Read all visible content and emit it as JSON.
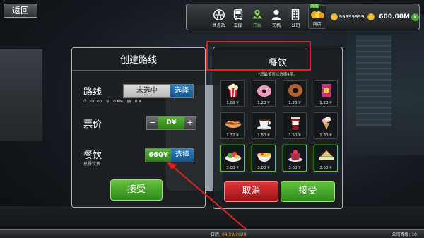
{
  "header": {
    "back_label": "返回",
    "nav": [
      {
        "label": "终点站",
        "icon": "terminal-icon"
      },
      {
        "label": "车库",
        "icon": "bus-icon"
      },
      {
        "label": "开始",
        "icon": "map-pin-icon",
        "active": true
      },
      {
        "label": "司机",
        "icon": "driver-icon"
      },
      {
        "label": "公司",
        "icon": "building-icon"
      }
    ],
    "shop": {
      "label": "商店",
      "discount": "折扣"
    },
    "coins": "99999999",
    "money": "600.00M",
    "money_badge": "¥"
  },
  "route_panel": {
    "title": "创建路线",
    "route_label": "路线",
    "route_value": "未选中",
    "route_select": "选择",
    "route_info": [
      "00:00",
      "0 KM",
      "0 ¥"
    ],
    "fare_label": "票价",
    "fare_minus": "−",
    "fare_value": "0¥",
    "fare_plus": "+",
    "food_label": "餐饮",
    "food_total": "660¥",
    "food_select": "选择",
    "food_sub": "总餐饮费",
    "accept": "接受"
  },
  "food_panel": {
    "title": "餐饮",
    "note": "*您最多可以选择4项。",
    "items": [
      {
        "name": "popcorn",
        "price": "1.08 ¥",
        "selected": false
      },
      {
        "name": "donut",
        "price": "1.20 ¥",
        "selected": false
      },
      {
        "name": "ring-donut",
        "price": "1.20 ¥",
        "selected": false
      },
      {
        "name": "chips",
        "price": "1.20 ¥",
        "selected": false
      },
      {
        "name": "hotdog",
        "price": "1.32 ¥",
        "selected": false
      },
      {
        "name": "coffee",
        "price": "1.50 ¥",
        "selected": false
      },
      {
        "name": "cola",
        "price": "1.50 ¥",
        "selected": false
      },
      {
        "name": "ice-cream",
        "price": "1.80 ¥",
        "selected": false
      },
      {
        "name": "salad",
        "price": "3.00 ¥",
        "selected": true
      },
      {
        "name": "noodles",
        "price": "3.00 ¥",
        "selected": true
      },
      {
        "name": "dessert",
        "price": "3.60 ¥",
        "selected": true
      },
      {
        "name": "sandwich",
        "price": "3.60 ¥",
        "selected": true
      }
    ],
    "cancel": "取消",
    "accept": "接受"
  },
  "status": {
    "date_label": "日历:",
    "date_value": "04/29/2020",
    "level": "公司等级: 10"
  },
  "colors": {
    "accent_green": "#49a52c",
    "accent_blue": "#1f6aa8",
    "cancel_red": "#c21f23",
    "annotation_red": "#e21e1e"
  }
}
